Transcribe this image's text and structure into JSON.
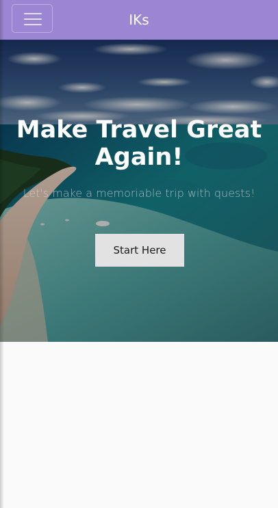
{
  "navbar": {
    "brand": "IKs",
    "menu_icon": "hamburger-menu-icon",
    "background_color": "#9b86d3"
  },
  "hero": {
    "title": "Make Travel Great Again!",
    "subtitle": "Let's make a memoriable trip with quests!",
    "cta_label": "Start Here",
    "background_image": "tropical-beach-aerial-photo"
  },
  "colors": {
    "page_background": "#fafafa",
    "button_background": "#e2e2e2"
  }
}
